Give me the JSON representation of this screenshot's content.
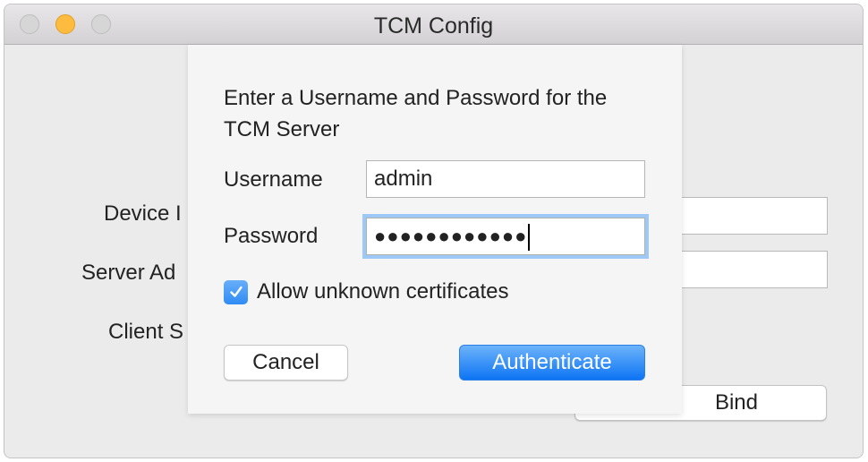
{
  "window": {
    "title": "TCM Config",
    "controls": {
      "close": "close-button",
      "minimize": "minimize-button",
      "zoom": "zoom-button"
    }
  },
  "background_form": {
    "labels": [
      "Device I",
      "Server Ad",
      "Client S"
    ],
    "bind_button_label": "Bind"
  },
  "sheet": {
    "message": "Enter a Username and Password for the TCM Server",
    "username_label": "Username",
    "username_value": "admin",
    "password_label": "Password",
    "password_masked": "●●●●●●●●●●●●",
    "password_length": 12,
    "allow_unknown_certs": {
      "label": "Allow unknown certificates",
      "checked": true
    },
    "cancel_label": "Cancel",
    "authenticate_label": "Authenticate"
  },
  "colors": {
    "accent": "#0d74f4",
    "focus_ring": "#9ec8f6",
    "minimize_yellow": "#fdbc40"
  }
}
